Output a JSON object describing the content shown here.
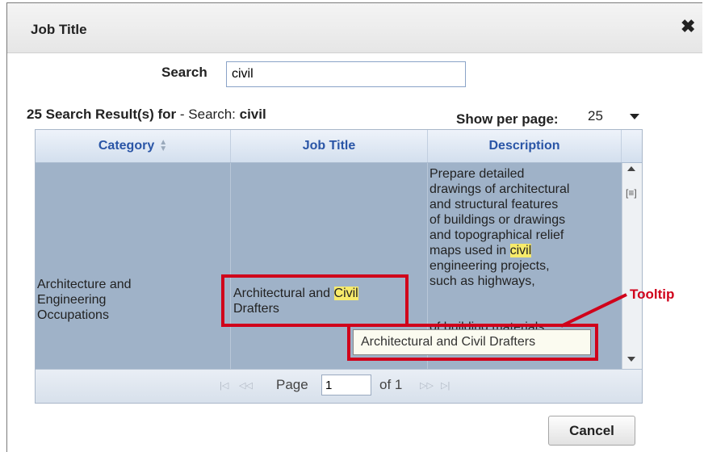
{
  "dialog": {
    "title": "Job Title",
    "close_icon": "close-icon"
  },
  "search": {
    "label": "Search",
    "value": "civil"
  },
  "results": {
    "count_text": "25 Search Result(s) for",
    "separator": " - Search: ",
    "term": "civil"
  },
  "per_page": {
    "label": "Show per page:",
    "value": "25"
  },
  "table": {
    "headers": [
      "Category",
      "Job Title",
      "Description"
    ],
    "row": {
      "category": [
        "Architecture and",
        "Engineering",
        "Occupations"
      ],
      "job_title_before": "Architectural and ",
      "job_title_highlight": "Civil",
      "job_title_after": "Drafters",
      "description_lines": [
        "Prepare detailed",
        "drawings of architectural",
        "and structural features",
        "of buildings or drawings",
        "and topographical relief",
        "maps used in ",
        "engineering projects,",
        "such as highways,",
        "",
        "",
        "of building materials"
      ],
      "description_highlight": "civil"
    }
  },
  "tooltip": {
    "text": "Architectural and Civil Drafters",
    "callout": "Tooltip"
  },
  "pager": {
    "first_icon": "first-page-icon",
    "prev_icon": "prev-page-icon",
    "next_icon": "next-page-icon",
    "last_icon": "last-page-icon",
    "page_label": "Page",
    "page_value": "1",
    "of_label": "of 1"
  },
  "buttons": {
    "cancel": "Cancel"
  },
  "colors": {
    "accent_text": "#2a55a6",
    "annotation_red": "#d0021b",
    "highlight": "#f7eb6b",
    "grid_body": "#9fb2c8"
  }
}
